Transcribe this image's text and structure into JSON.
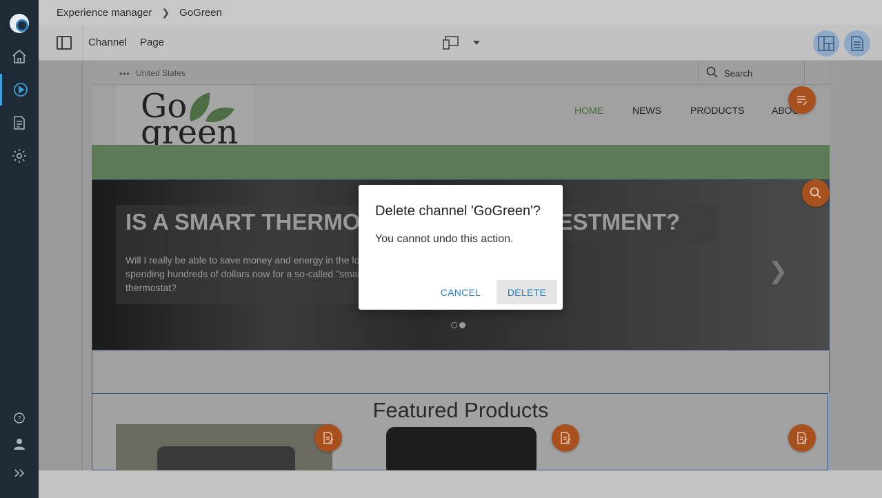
{
  "breadcrumb": {
    "root": "Experience manager",
    "current": "GoGreen"
  },
  "toolbar": {
    "channel": "Channel",
    "page": "Page"
  },
  "site": {
    "region": "United States",
    "search": "Search",
    "logo_line1": "Go",
    "logo_line2": "green",
    "nav": {
      "home": "HOME",
      "news": "NEWS",
      "products": "PRODUCTS",
      "about": "ABOUT"
    },
    "hero_title": "IS A SMART THERMOSTAT A GOOD INVESTMENT?",
    "hero_desc": "Will I really be able to save money and energy in the long run by spending hundreds of dollars now for a so-called \"smart\" thermostat?",
    "featured_title": "Featured Products"
  },
  "dialog": {
    "title": "Delete channel 'GoGreen'?",
    "message": "You cannot undo this action.",
    "cancel": "CANCEL",
    "delete": "DELETE"
  },
  "colors": {
    "accent": "#2a7fc0",
    "fab": "#e06b2b",
    "brand_green": "#8cc87a"
  }
}
